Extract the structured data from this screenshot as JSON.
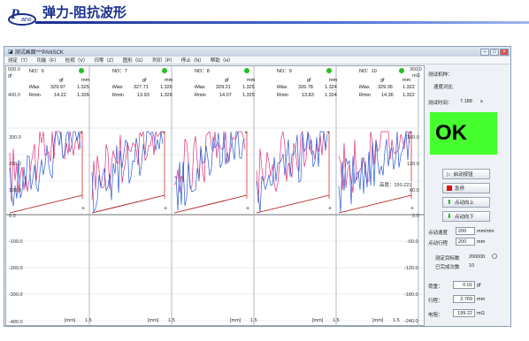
{
  "slide": {
    "title": "弹力-阻抗波形"
  },
  "window": {
    "title": "测试画面***PANSCK",
    "menu": [
      "测定（T）",
      "功能（F）",
      "检视（V）",
      "归零（Z）",
      "图形（G）",
      "列印（P）",
      "停止（N）",
      "帮助（H）"
    ]
  },
  "left_axis": {
    "top": "500.0",
    "unit": "gf",
    "second": "400.0"
  },
  "right_axis": {
    "top": "300.0",
    "unit": "mΩ"
  },
  "stat_headers": {
    "gf": "gf",
    "mm": "mm",
    "imax": "iMax",
    "rmin": "Rmin"
  },
  "panels": [
    {
      "no": "NO：6",
      "imax_gf": "329.97",
      "imax_mm": "1.325",
      "rmin_val": "14.22",
      "rmin_mm": "1.326"
    },
    {
      "no": "NO：7",
      "imax_gf": "327.71",
      "imax_mm": "1.326",
      "rmin_val": "13.93",
      "rmin_mm": "1.326"
    },
    {
      "no": "NO：8",
      "imax_gf": "329.21",
      "imax_mm": "1.325",
      "rmin_val": "14.07",
      "rmin_mm": "1.325"
    },
    {
      "no": "NO：9",
      "imax_gf": "326.78",
      "imax_mm": "1.324",
      "rmin_val": "13.83",
      "rmin_mm": "1.324"
    },
    {
      "no": "NO：10",
      "imax_gf": "329.36",
      "imax_mm": "1.322",
      "rmin_val": "14.36",
      "rmin_mm": "1.322"
    }
  ],
  "y_left_ticks": [
    "300.0",
    "200.0",
    "100.0",
    "0.0",
    "-100.0",
    "-200.0",
    "-300.0",
    "-400.0",
    "0.0"
  ],
  "y_right_ticks": [
    "180.0",
    "120.0",
    "60.0",
    "0.0",
    "-60.0",
    "-120.0",
    "-180.0",
    "-240.0"
  ],
  "x_axis": {
    "unit": "[mm]",
    "max": "1.5"
  },
  "cursor_readout": "高度：150.221",
  "side": {
    "machine_label": "测试机种：",
    "machine_value": "速度对比",
    "time_label": "测试时间：",
    "time_value": "7.188",
    "time_unit": "s",
    "result": "OK",
    "buttons": [
      "启动按钮",
      "急停",
      "点动向上",
      "点动向下"
    ],
    "speed_label": "点动速度",
    "speed_value": "200",
    "speed_unit": "mm/min",
    "travel_label": "点动行程",
    "travel_value": "200",
    "travel_unit": "mm",
    "count_label": "测定目标数",
    "count_value": "200000",
    "done_label": "已完成次数",
    "done_value": "10",
    "load_label": "荷重：",
    "load_value": "0.01",
    "load_unit": "gf",
    "stroke_label": "行程：",
    "stroke_value": "2.769",
    "stroke_unit": "mm",
    "res_label": "电阻：",
    "res_value": "199.22",
    "res_unit": "mΩ"
  },
  "colors": {
    "ok_bg": "#45ff2e",
    "force_curve": "#e0307a",
    "resist_curve": "#2a5bd7",
    "status_dot": "#22c022"
  }
}
